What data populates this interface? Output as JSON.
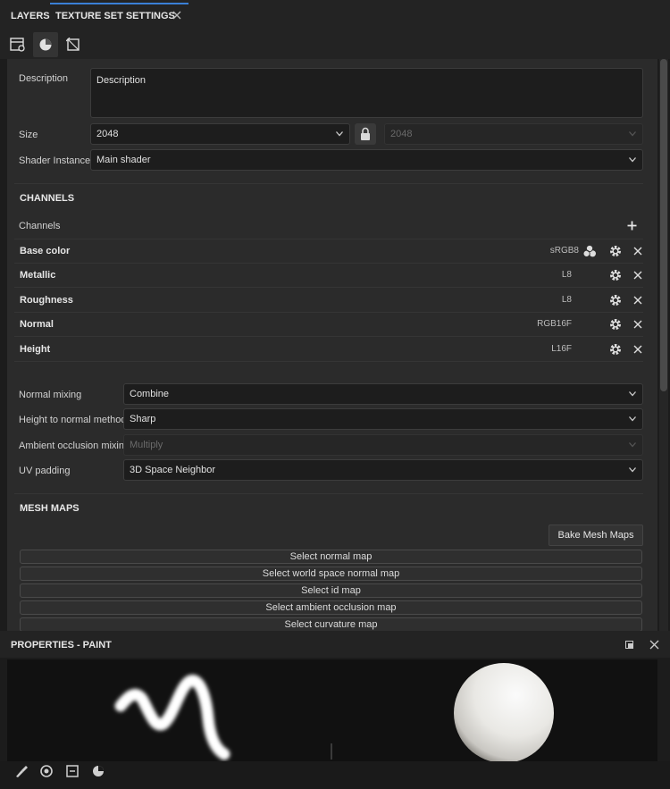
{
  "tabs": {
    "layers": "LAYERS",
    "texture_set_settings": "TEXTURE SET SETTINGS"
  },
  "settings": {
    "description_label": "Description",
    "description_value": "Description",
    "size_label": "Size",
    "size_value": "2048",
    "size_linked_value": "2048",
    "shader_label": "Shader Instance",
    "shader_value": "Main shader"
  },
  "channels": {
    "section_title": "CHANNELS",
    "list_label": "Channels",
    "items": [
      {
        "name": "Base color",
        "format": "sRGB8"
      },
      {
        "name": "Metallic",
        "format": "L8"
      },
      {
        "name": "Roughness",
        "format": "L8"
      },
      {
        "name": "Normal",
        "format": "RGB16F"
      },
      {
        "name": "Height",
        "format": "L16F"
      }
    ]
  },
  "options": {
    "normal_mixing_label": "Normal mixing",
    "normal_mixing_value": "Combine",
    "height_to_normal_label": "Height to normal method",
    "height_to_normal_value": "Sharp",
    "ao_mixing_label": "Ambient occlusion mixing",
    "ao_mixing_value": "Multiply",
    "uv_padding_label": "UV padding",
    "uv_padding_value": "3D Space Neighbor"
  },
  "mesh_maps": {
    "section_title": "MESH MAPS",
    "bake_button": "Bake Mesh Maps",
    "maps": [
      "Select normal map",
      "Select world space normal map",
      "Select id map",
      "Select ambient occlusion map",
      "Select curvature map"
    ]
  },
  "properties": {
    "title": "PROPERTIES - PAINT"
  },
  "colors": {
    "accent": "#3a7fd5",
    "panel_bg": "#2b2b2b",
    "field_bg": "#1d1d1d"
  }
}
